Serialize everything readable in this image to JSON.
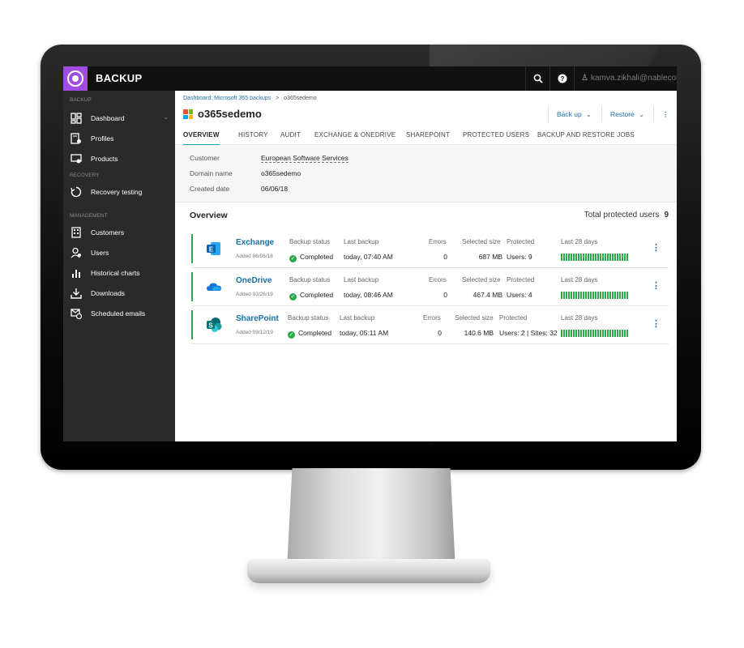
{
  "topbar": {
    "app_title": "BACKUP",
    "user_email": "kamva.zikhali@nablecorp.co..."
  },
  "sidebar": {
    "section_backup": "BACKUP",
    "section_recovery": "RECOVERY",
    "section_management": "MANAGEMENT",
    "items": [
      {
        "label": "Dashboard",
        "icon": "dashboard-icon"
      },
      {
        "label": "Profiles",
        "icon": "profiles-icon"
      },
      {
        "label": "Products",
        "icon": "products-icon"
      },
      {
        "label": "Recovery testing",
        "icon": "recovery-icon"
      },
      {
        "label": "Customers",
        "icon": "customers-icon"
      },
      {
        "label": "Users",
        "icon": "users-icon"
      },
      {
        "label": "Historical charts",
        "icon": "chart-icon"
      },
      {
        "label": "Downloads",
        "icon": "download-icon"
      },
      {
        "label": "Scheduled emails",
        "icon": "email-icon"
      }
    ]
  },
  "breadcrumb": {
    "link": "Dashboard: Microsoft 365 backups",
    "separator": ">",
    "current": "o365sedemo"
  },
  "page": {
    "title": "o365sedemo",
    "backup_btn": "Back up",
    "restore_btn": "Restore"
  },
  "tabs": [
    "OVERVIEW",
    "HISTORY",
    "AUDIT",
    "EXCHANGE & ONEDRIVE",
    "SHAREPOINT",
    "PROTECTED USERS",
    "BACKUP AND RESTORE JOBS"
  ],
  "info": [
    {
      "label": "Customer",
      "value": "European Software Services"
    },
    {
      "label": "Domain name",
      "value": "o365sedemo"
    },
    {
      "label": "Created date",
      "value": "06/06/18"
    }
  ],
  "overview": {
    "title": "Overview",
    "total_label": "Total protected users",
    "total_value": "9"
  },
  "headers": {
    "backup_status": "Backup status",
    "last_backup": "Last backup",
    "errors": "Errors",
    "selected_size": "Selected size",
    "protected": "Protected",
    "last_28": "Last 28 days"
  },
  "rows": [
    {
      "name": "Exchange",
      "added": "Added 06/06/18",
      "status": "Completed",
      "last_backup": "today, 07:40 AM",
      "errors": "0",
      "size": "687 MB",
      "protected": "Users: 9",
      "color": "#0a64b8"
    },
    {
      "name": "OneDrive",
      "added": "Added 03/26/19",
      "status": "Completed",
      "last_backup": "today, 08:46 AM",
      "errors": "0",
      "size": "467.4 MB",
      "protected": "Users: 4",
      "color": "#1577d4"
    },
    {
      "name": "SharePoint",
      "added": "Added 09/12/19",
      "status": "Completed",
      "last_backup": "today, 05:11 AM",
      "errors": "0",
      "size": "140.6 MB",
      "protected": "Users: 2 | Sites: 32",
      "color": "#067c76"
    }
  ]
}
